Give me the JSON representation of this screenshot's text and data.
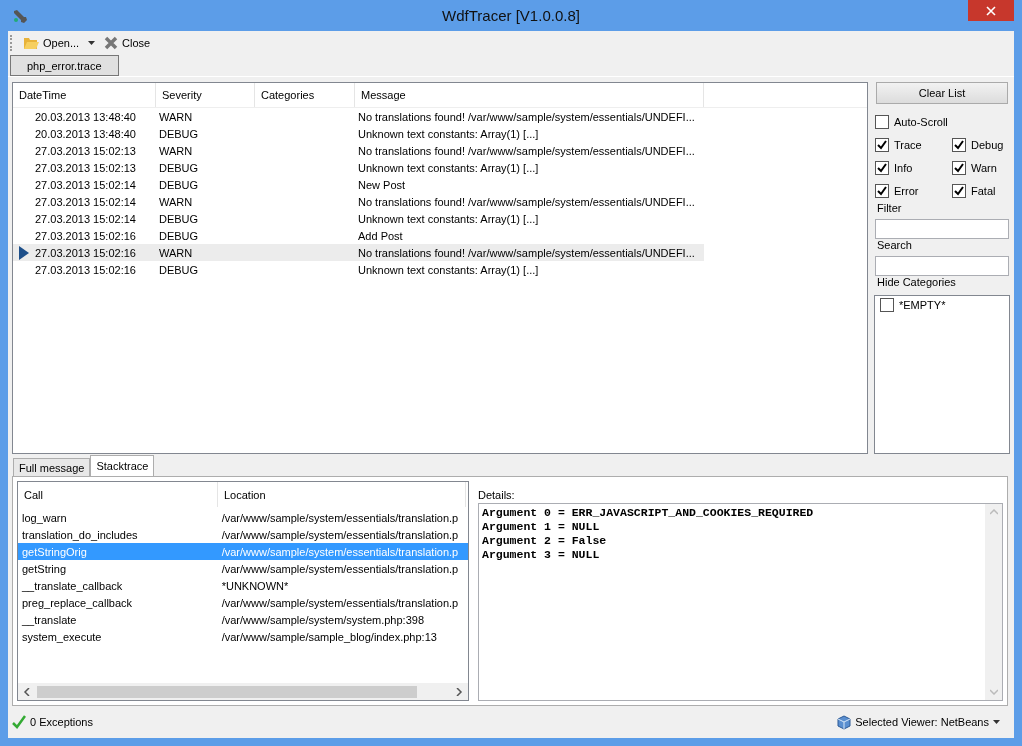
{
  "window": {
    "title": "WdfTracer [V1.0.0.8]"
  },
  "toolbar": {
    "open": "Open...",
    "close": "Close"
  },
  "file_tabs": [
    {
      "label": "php_error.trace",
      "selected": true
    }
  ],
  "log_table": {
    "columns": [
      "DateTime",
      "Severity",
      "Categories",
      "Message"
    ],
    "rows": [
      {
        "datetime": "20.03.2013 13:48:40",
        "severity": "WARN",
        "message": "No translations found! /var/www/sample/system/essentials/UNDEFI...",
        "selected": false
      },
      {
        "datetime": "20.03.2013 13:48:40",
        "severity": "DEBUG",
        "message": "Unknown text constants: Array(1) [...]",
        "selected": false
      },
      {
        "datetime": "27.03.2013 15:02:13",
        "severity": "WARN",
        "message": "No translations found! /var/www/sample/system/essentials/UNDEFI...",
        "selected": false
      },
      {
        "datetime": "27.03.2013 15:02:13",
        "severity": "DEBUG",
        "message": "Unknown text constants: Array(1) [...]",
        "selected": false
      },
      {
        "datetime": "27.03.2013 15:02:14",
        "severity": "DEBUG",
        "message": "New Post",
        "selected": false
      },
      {
        "datetime": "27.03.2013 15:02:14",
        "severity": "WARN",
        "message": "No translations found! /var/www/sample/system/essentials/UNDEFI...",
        "selected": false
      },
      {
        "datetime": "27.03.2013 15:02:14",
        "severity": "DEBUG",
        "message": "Unknown text constants: Array(1) [...]",
        "selected": false
      },
      {
        "datetime": "27.03.2013 15:02:16",
        "severity": "DEBUG",
        "message": "Add Post",
        "selected": false
      },
      {
        "datetime": "27.03.2013 15:02:16",
        "severity": "WARN",
        "message": "No translations found! /var/www/sample/system/essentials/UNDEFI...",
        "selected": true
      },
      {
        "datetime": "27.03.2013 15:02:16",
        "severity": "DEBUG",
        "message": "Unknown text constants: Array(1) [...]",
        "selected": false
      }
    ]
  },
  "side_panel": {
    "clear_button": "Clear List",
    "auto_scroll": {
      "label": "Auto-Scroll",
      "checked": false
    },
    "levels": [
      {
        "label": "Trace",
        "checked": true
      },
      {
        "label": "Debug",
        "checked": true
      },
      {
        "label": "Info",
        "checked": true
      },
      {
        "label": "Warn",
        "checked": true
      },
      {
        "label": "Error",
        "checked": true
      },
      {
        "label": "Fatal",
        "checked": true
      }
    ],
    "filter_label": "Filter",
    "search_label": "Search",
    "hide_categories_label": "Hide Categories",
    "categories": [
      {
        "label": "*EMPTY*",
        "checked": false
      }
    ]
  },
  "detail_tabs": [
    {
      "label": "Full message",
      "selected": false
    },
    {
      "label": "Stacktrace",
      "selected": true
    }
  ],
  "stacktrace": {
    "columns": [
      "Call",
      "Location"
    ],
    "rows": [
      {
        "call": "log_warn",
        "location": "/var/www/sample/system/essentials/translation.p",
        "selected": false
      },
      {
        "call": "translation_do_includes",
        "location": "/var/www/sample/system/essentials/translation.p",
        "selected": false
      },
      {
        "call": "getStringOrig",
        "location": "/var/www/sample/system/essentials/translation.p",
        "selected": true
      },
      {
        "call": "getString",
        "location": "/var/www/sample/system/essentials/translation.p",
        "selected": false
      },
      {
        "call": "__translate_callback",
        "location": "*UNKNOWN*",
        "selected": false
      },
      {
        "call": "preg_replace_callback",
        "location": "/var/www/sample/system/essentials/translation.p",
        "selected": false
      },
      {
        "call": "__translate",
        "location": "/var/www/sample/system/system.php:398",
        "selected": false
      },
      {
        "call": "system_execute",
        "location": "/var/www/sample/sample_blog/index.php:13",
        "selected": false
      }
    ]
  },
  "details": {
    "label": "Details:",
    "lines": [
      "Argument 0 = ERR_JAVASCRIPT_AND_COOKIES_REQUIRED",
      "Argument 1 = NULL",
      "Argument 2 = False",
      "Argument 3 = NULL"
    ]
  },
  "status_bar": {
    "exceptions": "0 Exceptions",
    "viewer": "Selected Viewer: NetBeans"
  }
}
